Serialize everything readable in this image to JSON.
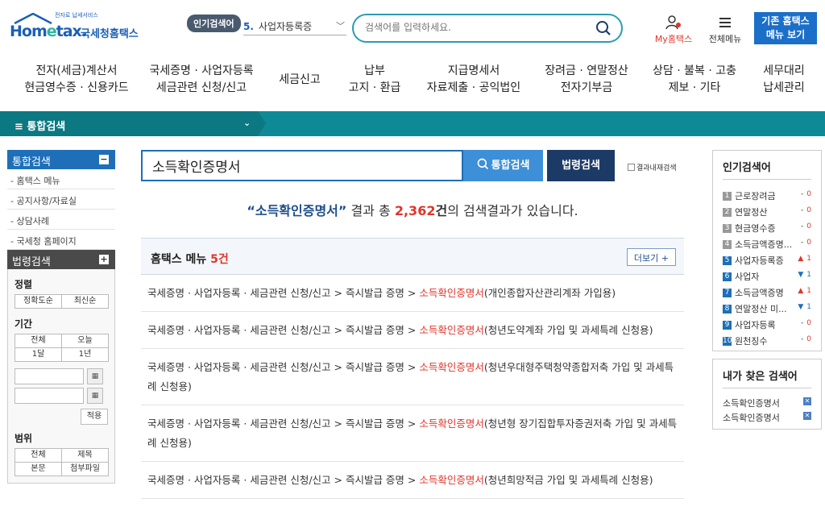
{
  "header": {
    "tagline": "전자로 납세서비스",
    "brand": "Hom",
    "brand_e": "e",
    "brand_tail": "tax.",
    "brand_kr": "국세청홈택스",
    "popular_badge": "인기검색어",
    "popular_num": "5.",
    "popular_term": "사업자등록증",
    "search_placeholder": "검색어를 입력하세요.",
    "my_hometax": "My홈택스",
    "all_menu": "전체메뉴",
    "old_home_line1": "기존 홈택스",
    "old_home_line2": "메뉴 보기"
  },
  "mainnav": [
    {
      "l1": "전자(세금)계산서",
      "l2": "현금영수증 · 신용카드"
    },
    {
      "l1": "국세증명 · 사업자등록",
      "l2": "세금관련 신청/신고"
    },
    {
      "l1": "세금신고",
      "l2": ""
    },
    {
      "l1": "납부",
      "l2": "고지 · 환급"
    },
    {
      "l1": "지급명세서",
      "l2": "자료제출 · 공익법인"
    },
    {
      "l1": "장려금 · 연말정산",
      "l2": "전자기부금"
    },
    {
      "l1": "상담 · 불복 · 고충",
      "l2": "제보 · 기타"
    },
    {
      "l1": "세무대리",
      "l2": "납세관리"
    }
  ],
  "teal": {
    "label": "≡  통합검색",
    "chev": "⌄"
  },
  "left": {
    "integrated_title": "통합검색",
    "integrated_toggle": "−",
    "links": [
      "- 홈택스 메뉴",
      "- 공지사항/자료실",
      "- 상담사례",
      "- 국세청 홈페이지"
    ],
    "law_title": "법령검색",
    "law_toggle": "+",
    "sort_title": "정렬",
    "sort_opts": [
      "정확도순",
      "최신순"
    ],
    "period_title": "기간",
    "period_opts_1": [
      "전체",
      "오늘"
    ],
    "period_opts_2": [
      "1달",
      "1년"
    ],
    "apply": "적용",
    "scope_title": "범위",
    "scope_opts_1": [
      "전체",
      "제목"
    ],
    "scope_opts_2": [
      "본문",
      "첨부파일"
    ]
  },
  "search": {
    "query": "소득확인증명서",
    "integrated_btn": "통합검색",
    "law_btn": "법령검색",
    "within": "결과내재검색"
  },
  "summary": {
    "keyword": "“소득확인증명서”",
    "pre": " 결과 총 ",
    "count": "2,362",
    "unit": "건",
    "post": "의 검색결과가 있습니다."
  },
  "result_head": {
    "title": "홈택스 메뉴 ",
    "count": "5건",
    "more": "더보기 +"
  },
  "results": [
    {
      "path": "국세증명 · 사업자등록 · 세금관련 신청/신고 > 즉시발급 증명 > ",
      "hl": "소득확인증명서",
      "tail": "(개인종합자산관리계좌 가입용)"
    },
    {
      "path": "국세증명 · 사업자등록 · 세금관련 신청/신고 > 즉시발급 증명 > ",
      "hl": "소득확인증명서",
      "tail": "(청년도약계좌 가입 및 과세특례 신청용)"
    },
    {
      "path": "국세증명 · 사업자등록 · 세금관련 신청/신고 > 즉시발급 증명 > ",
      "hl": "소득확인증명서",
      "tail": "(청년우대형주택청약종합저축 가입 및 과세특례 신청용)"
    },
    {
      "path": "국세증명 · 사업자등록 · 세금관련 신청/신고 > 즉시발급 증명 > ",
      "hl": "소득확인증명서",
      "tail": "(청년형 장기집합투자증권저축 가입 및 과세특례 신청용)"
    },
    {
      "path": "국세증명 · 사업자등록 · 세금관련 신청/신고 > 즉시발급 증명 > ",
      "hl": "소득확인증명서",
      "tail": "(청년희망적금 가입 및 과세특례 신청용)"
    }
  ],
  "popular": {
    "title": "인기검색어",
    "items": [
      {
        "rank": "1",
        "label": "근로장려금",
        "dir": "-",
        "val": "0"
      },
      {
        "rank": "2",
        "label": "연말정산",
        "dir": "-",
        "val": "0"
      },
      {
        "rank": "3",
        "label": "현금영수증",
        "dir": "-",
        "val": "0"
      },
      {
        "rank": "4",
        "label": "소득금액증명...",
        "dir": "-",
        "val": "0"
      },
      {
        "rank": "5",
        "label": "사업자등록증",
        "dir": "▲",
        "val": "1"
      },
      {
        "rank": "6",
        "label": "사업자",
        "dir": "▼",
        "val": "1"
      },
      {
        "rank": "7",
        "label": "소득금액증명",
        "dir": "▲",
        "val": "1"
      },
      {
        "rank": "8",
        "label": "연말정산 미...",
        "dir": "▼",
        "val": "1"
      },
      {
        "rank": "9",
        "label": "사업자등록",
        "dir": "-",
        "val": "0"
      },
      {
        "rank": "10",
        "label": "원천징수",
        "dir": "-",
        "val": "0"
      }
    ]
  },
  "mine": {
    "title": "내가 찾은 검색어",
    "items": [
      "소득확인증명서",
      "소득확인증명서"
    ]
  },
  "icons": {
    "search": "search-icon",
    "person": "person-icon",
    "hamburger": "hamburger-icon",
    "calendar": "calendar-icon",
    "close": "close-icon"
  }
}
